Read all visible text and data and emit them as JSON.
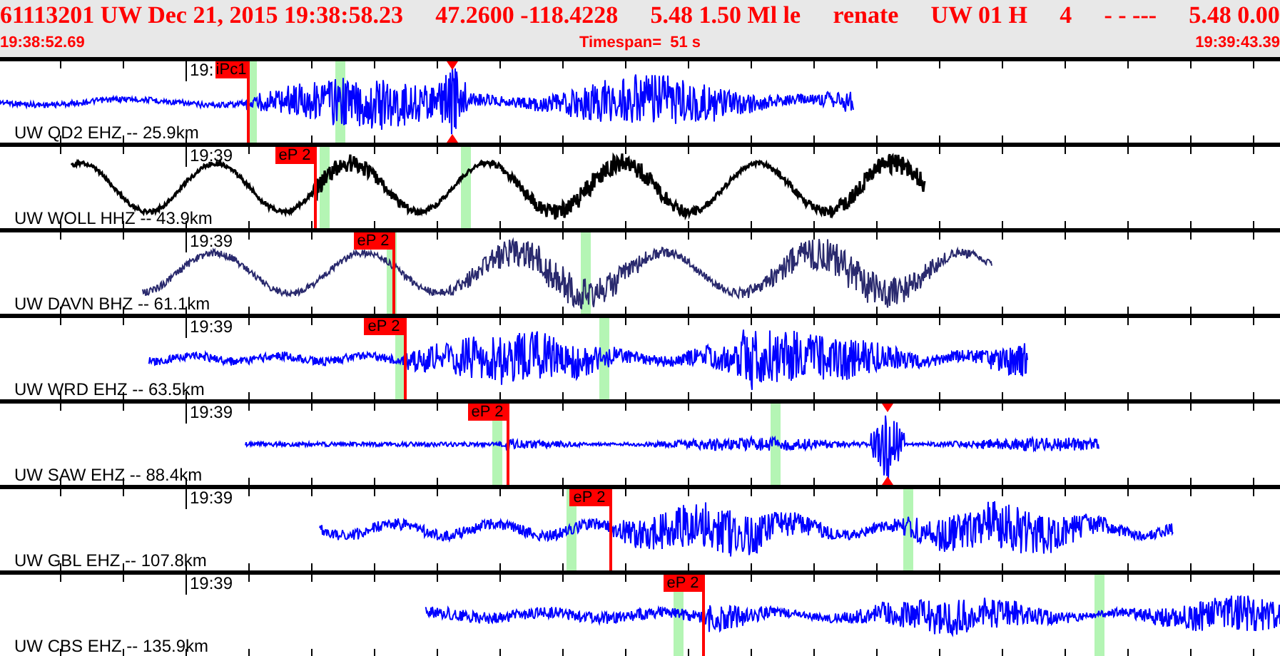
{
  "header": {
    "fields": [
      "61113201 UW Dec 21, 2015 19:38:58.23",
      "47.2600 -118.4228",
      "5.48 1.50 Ml le",
      "renate",
      "UW 01 H",
      "4",
      "- - ---",
      "5.48 0.00"
    ]
  },
  "time_bar": {
    "start": "19:38:52.69",
    "timespan": "Timespan=  51 s",
    "end": "19:39:43.39"
  },
  "traces": [
    {
      "channel": "UW QD2 EHZ -- 25.9km",
      "time_label": "19:",
      "pick": "iPc1",
      "color": "#0000ff",
      "peak_marker": true
    },
    {
      "channel": "UW WOLL HHZ -- 43.9km",
      "time_label": "19:39",
      "pick": "eP 2",
      "color": "#000000",
      "peak_marker": false
    },
    {
      "channel": "UW DAVN BHZ -- 61.1km",
      "time_label": "19:39",
      "pick": "eP 2",
      "color": "#2a2a6e",
      "peak_marker": false
    },
    {
      "channel": "UW WRD EHZ -- 63.5km",
      "time_label": "19:39",
      "pick": "eP 2",
      "color": "#0000ff",
      "peak_marker": false
    },
    {
      "channel": "UW SAW EHZ -- 88.4km",
      "time_label": "19:39",
      "pick": "eP 2",
      "color": "#0000ff",
      "peak_marker": true
    },
    {
      "channel": "UW GBL EHZ -- 107.8km",
      "time_label": "19:39",
      "pick": "eP 2",
      "color": "#0000ff",
      "peak_marker": false
    },
    {
      "channel": "UW CBS EHZ -- 135.9km",
      "time_label": "19:39",
      "pick": "eP 2",
      "color": "#0000ff",
      "peak_marker": false
    }
  ]
}
